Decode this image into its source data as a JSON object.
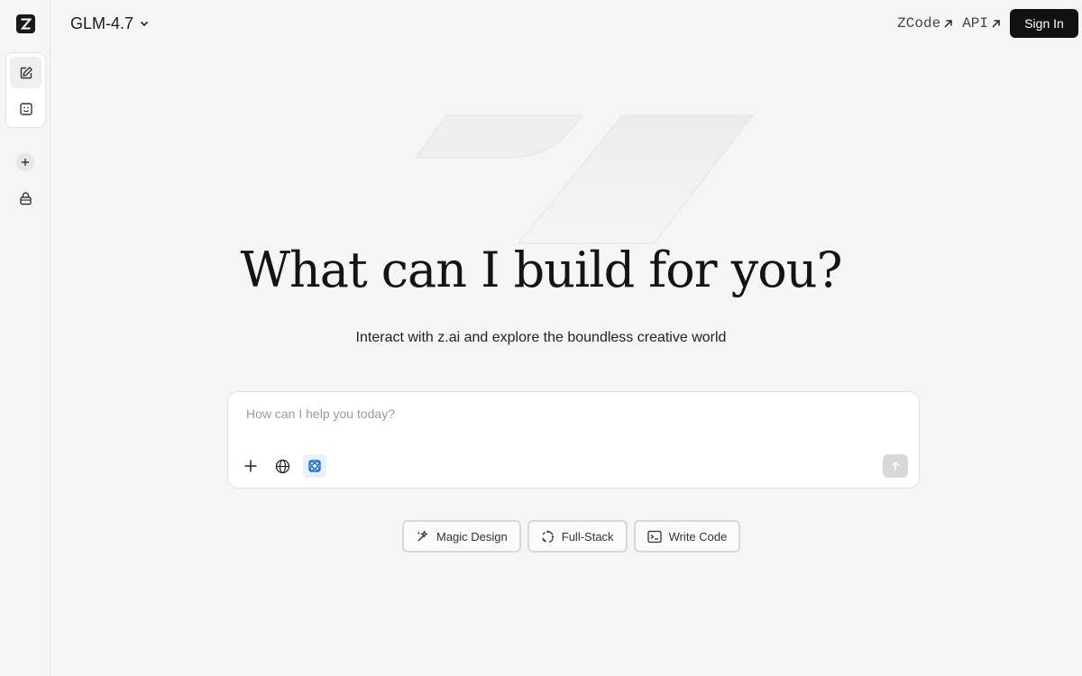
{
  "header": {
    "model_name": "GLM-4.7",
    "links": [
      "ZCode",
      "API"
    ],
    "signin_label": "Sign In"
  },
  "sidebar": {
    "items": [
      {
        "icon": "edit-icon",
        "label": "New chat"
      },
      {
        "icon": "agent-face-icon",
        "label": "Agents"
      },
      {
        "icon": "plus-icon",
        "label": "Add"
      },
      {
        "icon": "bag-icon",
        "label": "Library"
      }
    ]
  },
  "hero": {
    "title": "What can I build for you?",
    "subtitle": "Interact with z.ai and explore the boundless creative world"
  },
  "prompt": {
    "placeholder": "How can I help you today?",
    "tools": [
      "plus-icon",
      "globe-icon",
      "atom-icon"
    ],
    "send_icon": "arrow-up-icon"
  },
  "chips": [
    {
      "label": "Magic Design",
      "icon": "magic-icon"
    },
    {
      "label": "Full-Stack",
      "icon": "cycle-icon"
    },
    {
      "label": "Write Code",
      "icon": "terminal-icon"
    }
  ],
  "colors": {
    "accent": "#1f6fd1",
    "background": "#f5f5f5",
    "dark": "#111111"
  }
}
